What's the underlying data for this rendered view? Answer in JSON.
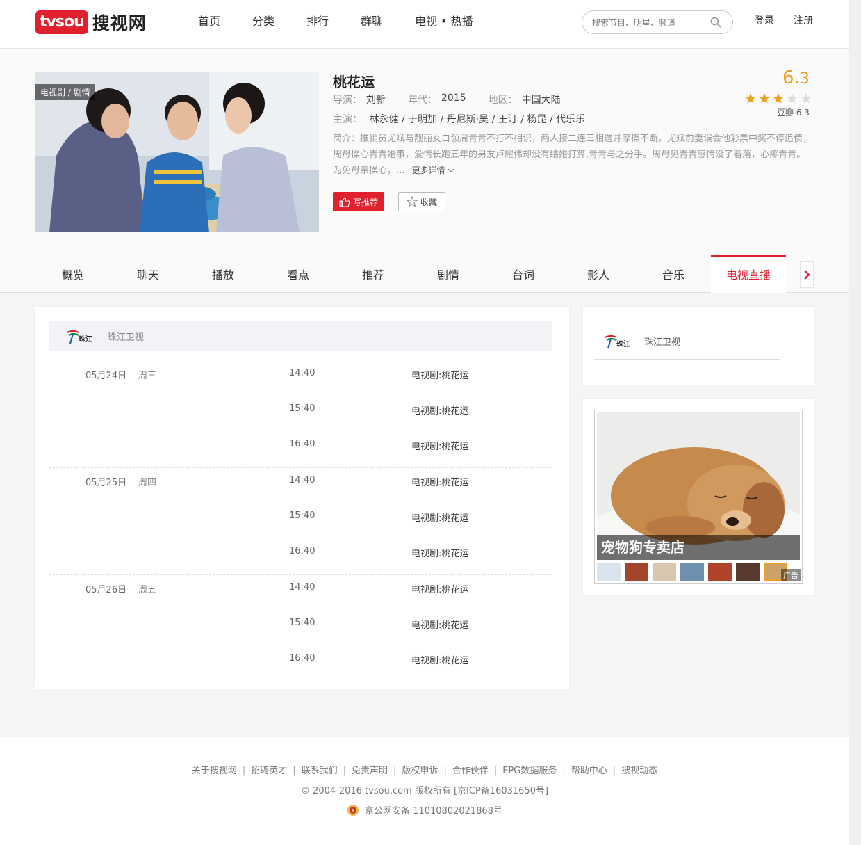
{
  "header": {
    "logo_badge": "tvsou",
    "logo_text": "搜视网",
    "nav": [
      "首页",
      "分类",
      "排行",
      "群聊",
      "电视 • 热播"
    ],
    "search_placeholder": "搜索节目、明星、频道",
    "login": "登录",
    "register": "注册"
  },
  "program": {
    "poster_tag": "电视剧 / 剧情",
    "title": "桃花运",
    "director_label": "导演：",
    "director": "刘新",
    "year_label": "年代：",
    "year": "2015",
    "region_label": "地区：",
    "region": "中国大陆",
    "cast_label": "主演：",
    "cast": "林永健 / 于明加 / 丹尼斯·吴 / 王汀 / 杨昆 / 代乐乐",
    "synopsis": "简介：推销员尤斌与靓丽女白领周青青不打不相识，两人接二连三相遇并摩擦不断。尤斌前妻误会他彩票中奖不停追债；周母操心青青婚事，爱情长跑五年的男友卢耀伟却没有结婚打算,青青与之分手。周母见青青感情没了着落，心疼青青。为免母亲操心，...",
    "more": "更多详情",
    "recommend_btn": "写推荐",
    "fav_btn": "收藏",
    "score_int": "6.",
    "score_dec": "3",
    "stars_filled": 3,
    "stars_total": 5,
    "douban": "豆瓣 6.3"
  },
  "tabs": [
    "概览",
    "聊天",
    "播放",
    "看点",
    "推荐",
    "剧情",
    "台词",
    "影人",
    "音乐",
    "电视直播"
  ],
  "active_tab": 9,
  "schedule": {
    "channel": "珠江卫视",
    "channel_logo_text": "珠江",
    "days": [
      {
        "date": "05月24日",
        "week": "周三",
        "slots": [
          {
            "time": "14:40",
            "prog": "电视剧:桃花运"
          },
          {
            "time": "15:40",
            "prog": "电视剧:桃花运"
          },
          {
            "time": "16:40",
            "prog": "电视剧:桃花运"
          }
        ]
      },
      {
        "date": "05月25日",
        "week": "周四",
        "slots": [
          {
            "time": "14:40",
            "prog": "电视剧:桃花运"
          },
          {
            "time": "15:40",
            "prog": "电视剧:桃花运"
          },
          {
            "time": "16:40",
            "prog": "电视剧:桃花运"
          }
        ]
      },
      {
        "date": "05月26日",
        "week": "周五",
        "slots": [
          {
            "time": "14:40",
            "prog": "电视剧:桃花运"
          },
          {
            "time": "15:40",
            "prog": "电视剧:桃花运"
          },
          {
            "time": "16:40",
            "prog": "电视剧:桃花运"
          }
        ]
      }
    ]
  },
  "side": {
    "channel": "珠江卫视",
    "channel_logo_text": "珠江"
  },
  "ad": {
    "caption": "宠物狗专卖店",
    "badge": "广告",
    "thumb_colors": [
      "#d9e4ee",
      "#a3452a",
      "#d8c7b0",
      "#6e8fb0",
      "#b0442a",
      "#5a3a2e",
      "#c9a36a"
    ]
  },
  "footer": {
    "links": [
      "关于搜视网",
      "招聘英才",
      "联系我们",
      "免责声明",
      "版权申诉",
      "合作伙伴",
      "EPG数据服务",
      "帮助中心",
      "搜视动态"
    ],
    "copyright": "© 2004-2016 tvsou.com 版权所有 [京ICP备16031650号]",
    "icp": "京公网安备 11010802021868号"
  },
  "colors": {
    "brand_red": "#e0202c",
    "score_orange": "#f0a020"
  }
}
